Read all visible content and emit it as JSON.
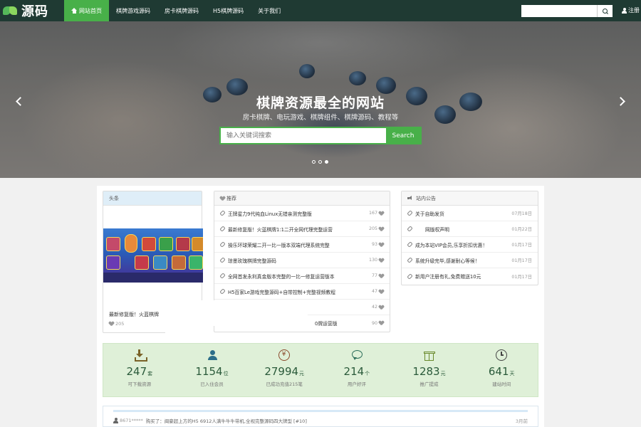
{
  "brand": {
    "name": "源码"
  },
  "nav": {
    "items": [
      {
        "label": "网站首页",
        "active": true
      },
      {
        "label": "棋牌游戏源码",
        "active": false
      },
      {
        "label": "房卡棋牌源码",
        "active": false
      },
      {
        "label": "H5棋牌源码",
        "active": false
      },
      {
        "label": "关于我们",
        "active": false
      }
    ],
    "search_placeholder": "",
    "user_label": "注册"
  },
  "hero": {
    "title": "棋牌资源最全的网站",
    "subtitle": "房卡棋牌、电玩游戏、棋牌组件、棋牌源码、教程等",
    "search_placeholder": "输入关键词搜索",
    "search_button": "Search",
    "slide_count": 3,
    "active_slide": 3
  },
  "headline": {
    "title": "头条",
    "feature_title": "最新修复版！火蓝棋牌",
    "feature_likes": "205"
  },
  "recommend": {
    "title": "推荐",
    "items": [
      {
        "title": "王牌星力9代纯血Linux无错亲测完整版",
        "count": "167"
      },
      {
        "title": "最新修复版！火蓝棋牌1:1二开全网代理完整运营",
        "count": "205"
      },
      {
        "title": "操乐环球荣耀二开一比一版本双端代理系统完整",
        "count": "93"
      },
      {
        "title": "琼墨玫瑰棋牌完整源码",
        "count": "130"
      },
      {
        "title": "全网首发永利真金版本完整的一比一修复运营版本",
        "count": "77"
      },
      {
        "title": "H5百家Le游戏完整源码+自带控制+完整视频教程",
        "count": "47"
      },
      {
        "title": "",
        "count": "42"
      },
      {
        "title": "",
        "count": "90",
        "partial": "0牌运营版"
      }
    ]
  },
  "notices": {
    "title": "站内公告",
    "items": [
      {
        "title": "关于自助发货",
        "date": "07月18日"
      },
      {
        "title": "网版权声明",
        "date": "01月22日"
      },
      {
        "title": "成为本站VIP会员,乐享折扣优惠！",
        "date": "01月17日"
      },
      {
        "title": "系统升级完毕,感谢耐心等候！",
        "date": "01月17日"
      },
      {
        "title": "新用户注册有礼,免费赠送10元",
        "date": "01月17日"
      }
    ]
  },
  "stats": [
    {
      "icon": "download-icon",
      "value": "247",
      "unit": "套",
      "label": "可下载资源"
    },
    {
      "icon": "users-icon",
      "value": "1154",
      "unit": "位",
      "label": "已入住会员"
    },
    {
      "icon": "coin-icon",
      "value": "27994",
      "unit": "元",
      "label": "已成功充值215笔"
    },
    {
      "icon": "chat-icon",
      "value": "214",
      "unit": "个",
      "label": "用户好评"
    },
    {
      "icon": "gift-icon",
      "value": "1283",
      "unit": "元",
      "label": "推广提成"
    },
    {
      "icon": "clock-icon",
      "value": "641",
      "unit": "天",
      "label": "建站时间"
    }
  ],
  "ticker": {
    "name": "8671*****",
    "text": "购买了：闽豪超上方的H5 6912人满牛牛牛带机,全视完整源码四大牌型 [#10]",
    "time": "3月前"
  }
}
